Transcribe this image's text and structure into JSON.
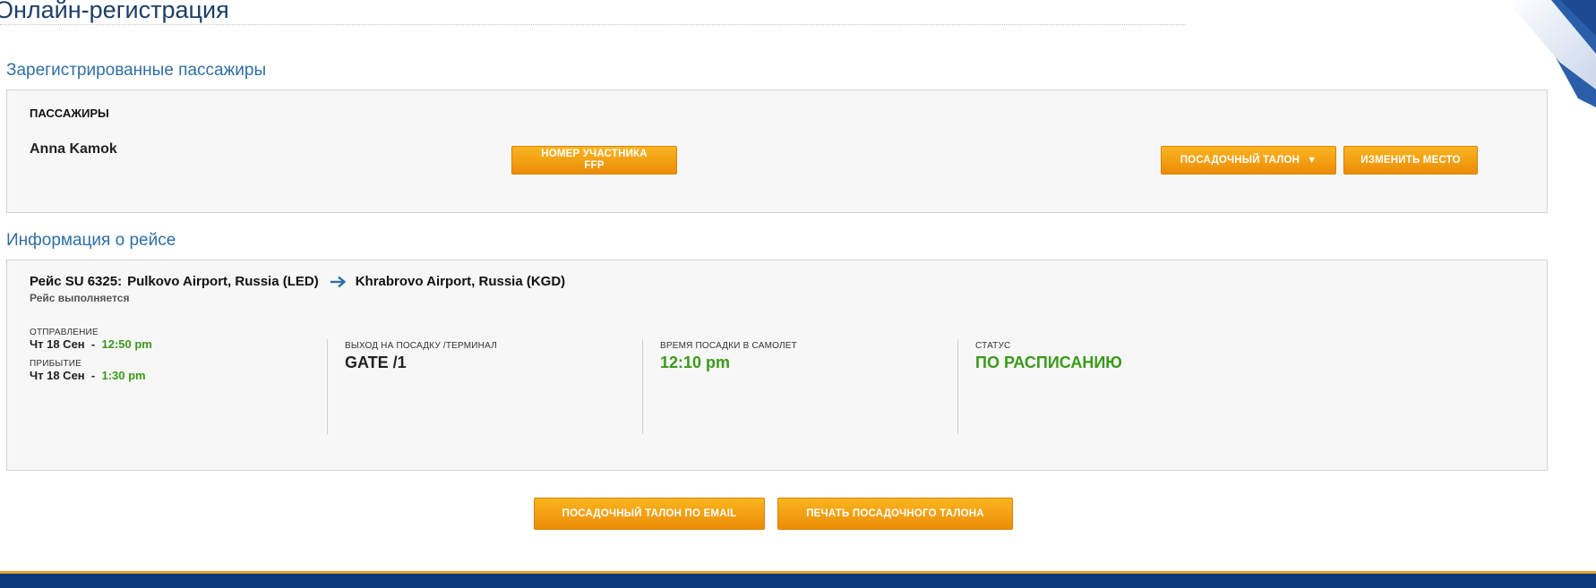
{
  "page": {
    "title": "Онлайн-регистрация"
  },
  "passengers_section": {
    "heading": "Зарегистрированные пассажиры",
    "column_label": "ПАССАЖИРЫ",
    "passenger_name": "Anna Kamok",
    "ffp_button_line1": "НОМЕР УЧАСТНИКА",
    "ffp_button_line2": "FFP",
    "boarding_pass_button": "ПОСАДОЧНЫЙ ТАЛОН",
    "change_seat_button": "ИЗМЕНИТЬ МЕСТО"
  },
  "flight_section": {
    "heading": "Информация о рейсе",
    "flight_label": "Рейс SU 6325:",
    "origin": "Pulkovo Airport, Russia (LED)",
    "destination": "Khrabrovo Airport, Russia (KGD)",
    "status_note": "Рейс выполняется",
    "departure_label": "ОТПРАВЛЕНИЕ",
    "departure_date": "Чт 18 Сен",
    "departure_time": "12:50 pm",
    "arrival_label": "ПРИБЫТИЕ",
    "arrival_date": "Чт 18 Сен",
    "arrival_time": "1:30 pm",
    "separator": "-",
    "gate_label": "ВЫХОД НА ПОСАДКУ /ТЕРМИНАЛ",
    "gate_value": "GATE /1",
    "boarding_time_label": "ВРЕМЯ ПОСАДКИ В САМОЛЕТ",
    "boarding_time_value": "12:10 pm",
    "status_label": "СТАТУС",
    "status_value": "ПО РАСПИСАНИЮ"
  },
  "actions": {
    "email_button": "ПОСАДОЧНЫЙ ТАЛОН ПО EMAIL",
    "print_button": "ПЕЧАТЬ ПОСАДОЧНОГО ТАЛОНА"
  },
  "colors": {
    "accent_orange": "#f5a011",
    "status_green": "#3a9a1a",
    "heading_blue": "#2f6fa3",
    "footer_navy": "#0a3a7a"
  },
  "icons": {
    "route_arrow": "arrow-right-icon",
    "dropdown_caret": "caret-down-icon"
  }
}
